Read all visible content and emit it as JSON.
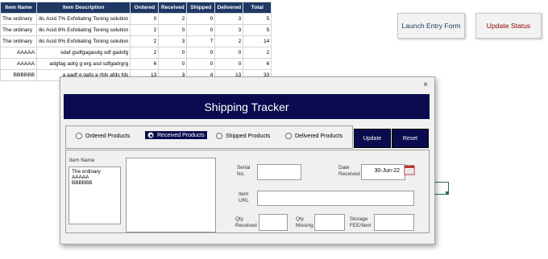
{
  "sheet": {
    "headers": [
      "Item Name",
      "Item Description",
      "Ordered",
      "Received",
      "Shipped",
      "Delivered",
      "Total"
    ],
    "rows": [
      [
        "The ordinary",
        "ilic Acid 7% Exfoliating Toning solution",
        "0",
        "2",
        "0",
        "3",
        "5"
      ],
      [
        "The ordinary",
        "ilic Acid 8% Exfoliating Toning solution",
        "2",
        "0",
        "0",
        "3",
        "5"
      ],
      [
        "The ordinary",
        "ilic Acid 9% Exfoliating Toning solution",
        "2",
        "3",
        "7",
        "2",
        "14"
      ],
      [
        "AAAAA",
        "sdaf gsdfgagasdg sdf gadsfg",
        "2",
        "0",
        "0",
        "0",
        "2"
      ],
      [
        "AAAAA",
        "adgfag adrg g erg asd sdfgadrgrg",
        "6",
        "0",
        "0",
        "0",
        "6"
      ],
      [
        "BBBBBB",
        "a aadf g gafg a rfdv afds fds",
        "13",
        "3",
        "4",
        "13",
        "33"
      ]
    ],
    "launch_button": "Launch Entry Form",
    "status_button": "Update Status"
  },
  "dialog": {
    "close": "×",
    "title": "Shipping Tracker",
    "radios": [
      "Ordered Products",
      "Received Products",
      "Shipped Products",
      "Delivered Products"
    ],
    "selected_radio": "Received Products",
    "update_button": "Update",
    "reset_button": "Reset",
    "item_name_label": "Item Name",
    "item_list": [
      "The ordinary",
      "AAAAA",
      "BBBBBB"
    ],
    "serial_label": "Serial No.",
    "date_label": "Date Received",
    "date_value": "30-Jun-22",
    "url_label": "Item URL",
    "qty_received_label": "Qty Received",
    "qty_missing_label": "Qty Missing",
    "storage_label": "Storage FEE/Item"
  },
  "colors": {
    "header_bg": "#1f3864",
    "banner_bg": "#0a0a4e",
    "status_text": "#8b0000"
  },
  "icons": {
    "close": "close-icon",
    "calendar": "calendar-icon"
  }
}
